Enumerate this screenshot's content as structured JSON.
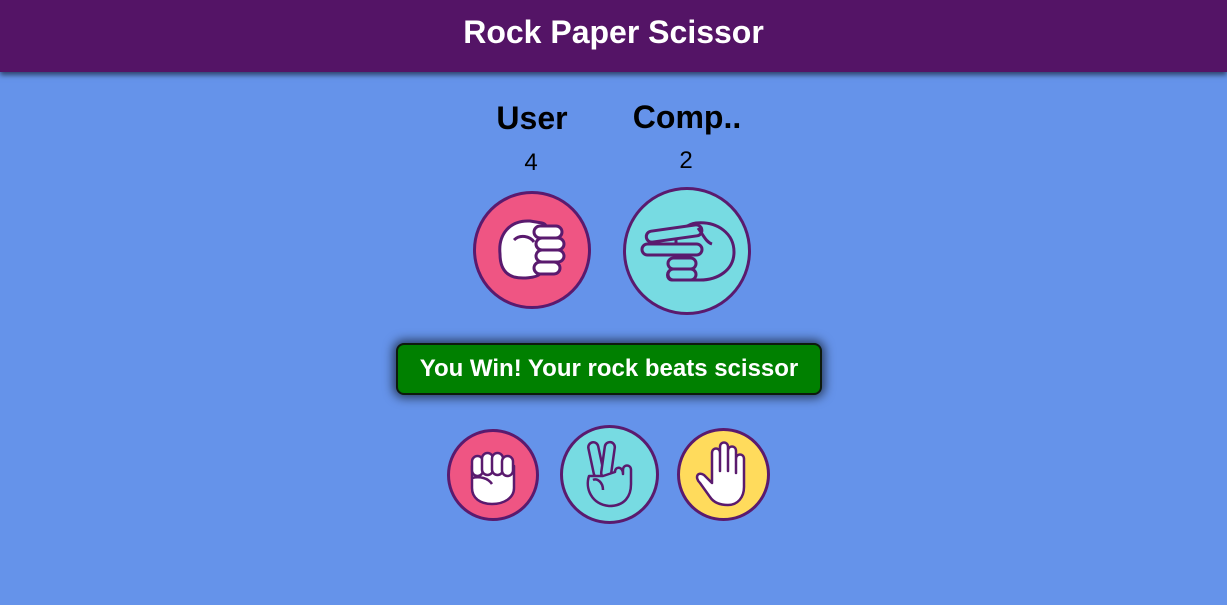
{
  "app": {
    "title": "Rock Paper Scissor"
  },
  "scoreboard": {
    "user_label": "User",
    "user_score": "4",
    "comp_label": "Comp..",
    "comp_score": "2"
  },
  "current_round": {
    "user_choice": "rock",
    "comp_choice": "scissor"
  },
  "message": {
    "text": "You Win! Your rock beats scissor",
    "color": "#008000"
  },
  "choices": [
    {
      "name": "rock",
      "icon": "fist-icon",
      "color": "#ef5583"
    },
    {
      "name": "scissor",
      "icon": "peace-hand-icon",
      "color": "#77dbe2"
    },
    {
      "name": "paper",
      "icon": "open-palm-icon",
      "color": "#ffdb5c"
    }
  ],
  "colors": {
    "header_bg": "#541466",
    "page_bg": "#6593ea",
    "outline": "#5a1a6e"
  }
}
